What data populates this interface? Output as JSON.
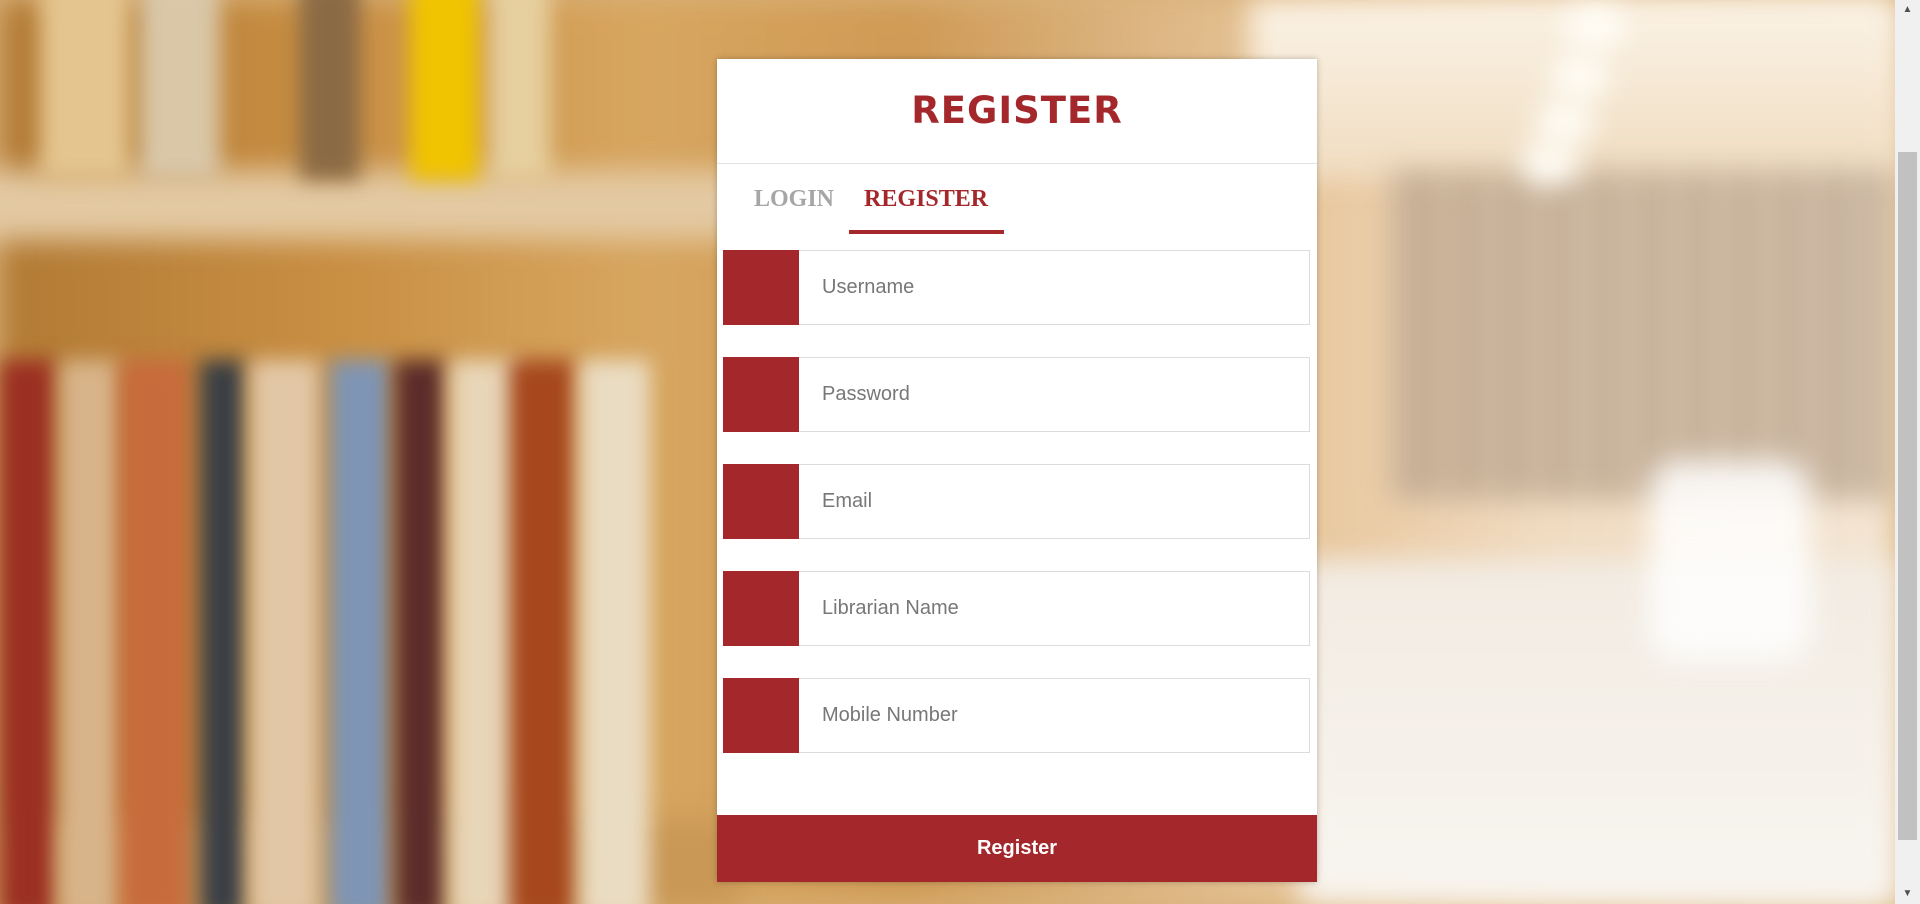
{
  "header": {
    "title": "REGISTER"
  },
  "tabs": [
    {
      "label": "LOGIN",
      "active": false
    },
    {
      "label": "REGISTER",
      "active": true
    }
  ],
  "form": {
    "fields": [
      {
        "placeholder": "Username",
        "value": "",
        "icon": "user-icon"
      },
      {
        "placeholder": "Password",
        "value": "",
        "icon": "lock-icon"
      },
      {
        "placeholder": "Email",
        "value": "",
        "icon": "envelope-icon"
      },
      {
        "placeholder": "Librarian Name",
        "value": "",
        "icon": "id-card-icon"
      },
      {
        "placeholder": "Mobile Number",
        "value": "",
        "icon": "phone-icon"
      }
    ],
    "submit_label": "Register"
  },
  "colors": {
    "accent": "#a4282b",
    "inactive_tab": "#a6a6a6",
    "card_background": "#ffffff"
  }
}
